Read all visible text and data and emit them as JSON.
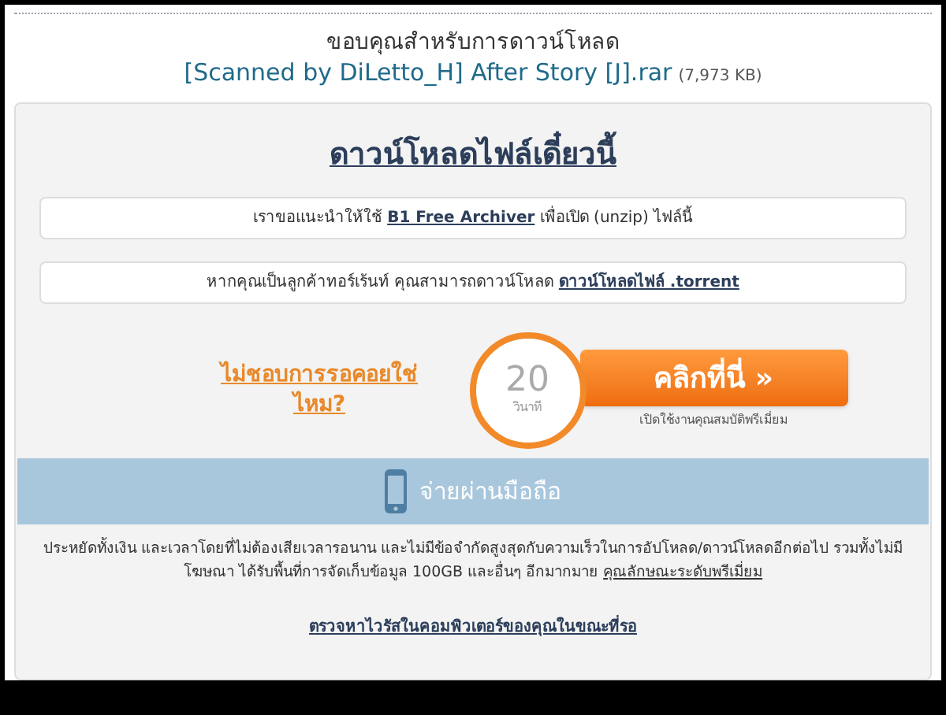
{
  "header": {
    "thanks": "ขอบคุณสำหรับการดาวน์โหลด",
    "file_name": "[Scanned by DiLetto_H] After Story [J].rar",
    "file_size": "(7,973 KB)"
  },
  "panel": {
    "title": "ดาวน์โหลดไฟล์เดี๋ยวนี้",
    "notices": [
      {
        "before": "เราขอแนะนำให้ใช้",
        "link": "B1 Free Archiver",
        "after": "เพื่อเปิด (unzip) ไฟล์นี้"
      },
      {
        "before": "หากคุณเป็นลูกค้าทอร์เร้นท์ คุณสามารถดาวน์โหลด",
        "link": "ดาวน์โหลดไฟล์ .torrent"
      }
    ],
    "wait_link": "ไม่ชอบการรอคอยใช่ไหม?",
    "countdown": {
      "number": "20",
      "unit": "วินาที"
    },
    "click_button": "คลิกที่นี่ »",
    "premium_note": "เปิดใช้งานคุณสมบัติพรีเมี่ยม",
    "mobile_banner": "จ่ายผ่านมือถือ",
    "promo": {
      "text": "ประหยัดทั้งเงิน และเวลาโดยที่ไม่ต้องเสียเวลารอนาน และไม่มีข้อจำกัดสูงสุดกับความเร็วในการอัปโหลด/ดาวน์โหลดอีกต่อไป รวมทั้งไม่มีโฆษณา ได้รับพื้นที่การจัดเก็บข้อมูล 100GB และอื่นๆ อีกมากมาย",
      "link": "คุณลักษณะระดับพรีเมี่ยม"
    },
    "virus_link": "ตรวจหาไวรัสในคอมพิวเตอร์ของคุณในขณะที่รอ"
  }
}
